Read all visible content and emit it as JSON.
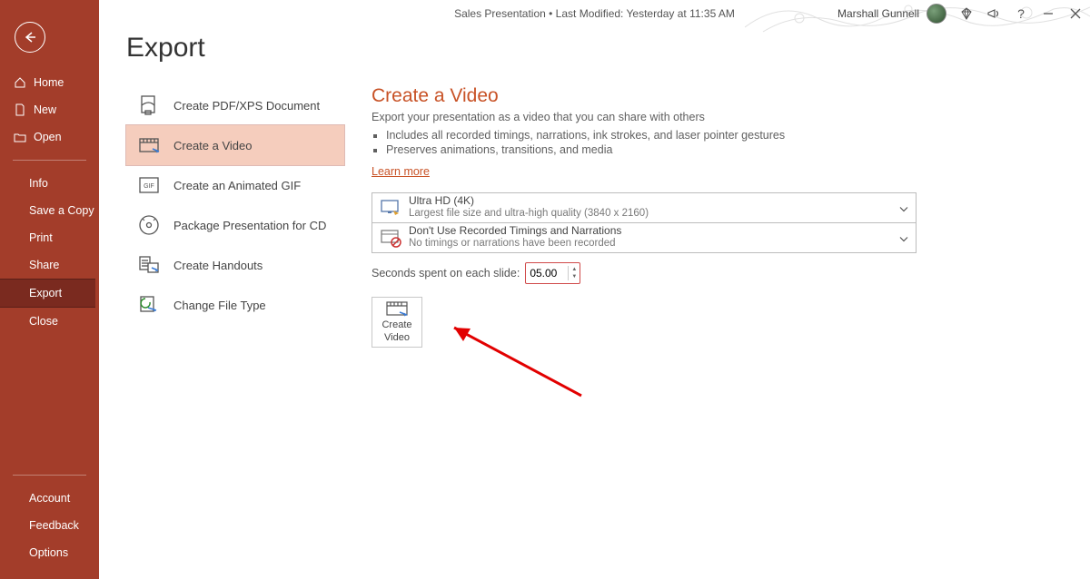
{
  "titlebar": {
    "title": "Sales Presentation • Last Modified: Yesterday at 11:35 AM",
    "username": "Marshall Gunnell"
  },
  "sidebar": {
    "home": "Home",
    "new": "New",
    "open": "Open",
    "info": "Info",
    "save_copy": "Save a Copy",
    "print": "Print",
    "share": "Share",
    "export": "Export",
    "close": "Close",
    "account": "Account",
    "feedback": "Feedback",
    "options": "Options"
  },
  "page": {
    "title": "Export"
  },
  "export_options": {
    "pdf": "Create PDF/XPS Document",
    "video": "Create a Video",
    "gif": "Create an Animated GIF",
    "package": "Package Presentation for CD",
    "handouts": "Create Handouts",
    "change": "Change File Type"
  },
  "detail": {
    "heading": "Create a Video",
    "sub": "Export your presentation as a video that you can share with others",
    "bullet1": "Includes all recorded timings, narrations, ink strokes, and laser pointer gestures",
    "bullet2": "Preserves animations, transitions, and media",
    "learn": "Learn more",
    "res_title": "Ultra HD (4K)",
    "res_sub": "Largest file size and ultra-high quality (3840 x 2160)",
    "tim_title": "Don't Use Recorded Timings and Narrations",
    "tim_sub": "No timings or narrations have been recorded",
    "spent_label": "Seconds spent on each slide:",
    "spent_value": "05.00",
    "create_l1": "Create",
    "create_l2": "Video"
  }
}
